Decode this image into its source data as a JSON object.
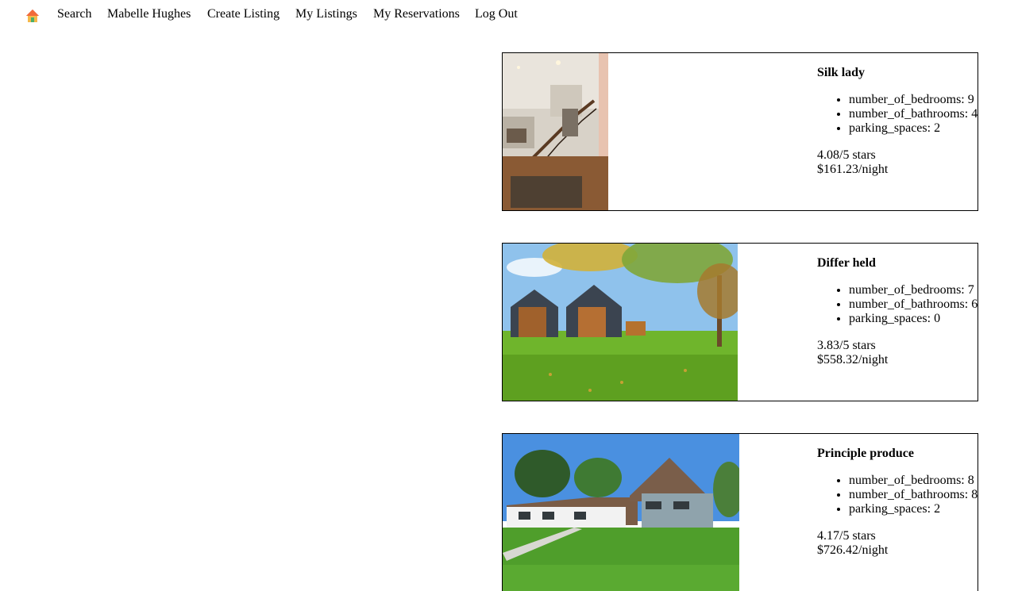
{
  "nav": {
    "home_icon": "home-icon",
    "links": [
      "Search",
      "Mabelle Hughes",
      "Create Listing",
      "My Listings",
      "My Reservations",
      "Log Out"
    ]
  },
  "listings": [
    {
      "title": "Silk lady",
      "image": "interior-staircase-photo",
      "features": [
        "number_of_bedrooms: 9",
        "number_of_bathrooms: 4",
        "parking_spaces: 2"
      ],
      "rating": "4.08/5 stars",
      "price": "$161.23/night"
    },
    {
      "title": "Differ held",
      "image": "modern-barn-houses-photo",
      "features": [
        "number_of_bedrooms: 7",
        "number_of_bathrooms: 6",
        "parking_spaces: 0"
      ],
      "rating": "3.83/5 stars",
      "price": "$558.32/night"
    },
    {
      "title": "Principle produce",
      "image": "white-house-lawn-photo",
      "features": [
        "number_of_bedrooms: 8",
        "number_of_bathrooms: 8",
        "parking_spaces: 2"
      ],
      "rating": "4.17/5 stars",
      "price": "$726.42/night"
    }
  ]
}
